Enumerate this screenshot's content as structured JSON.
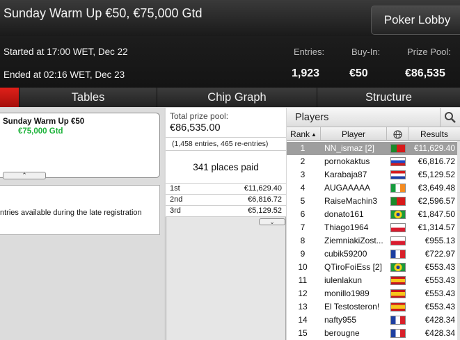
{
  "header": {
    "title": "Sunday Warm Up €50, €75,000 Gtd",
    "lobby_button": "Poker Lobby",
    "started": "Started at 17:00 WET, Dec 22",
    "ended": "Ended at 02:16 WET, Dec 23",
    "entries_label": "Entries:",
    "entries_value": "1,923",
    "buyin_label": "Buy-In:",
    "buyin_value": "€50",
    "prize_label": "Prize Pool:",
    "prize_value": "€86,535"
  },
  "tabs": [
    "Tables",
    "Chip Graph",
    "Structure"
  ],
  "left": {
    "card_name": "Sunday Warm Up €50",
    "card_gtd": "€75,000 Gtd",
    "info_text": "ntries available during the late registration"
  },
  "middle": {
    "pool_label": "Total prize pool:",
    "pool_value": "€86,535.00",
    "entries_text": "(1,458 entries, 465 re-entries)",
    "places_paid": "341 places paid",
    "payouts": [
      {
        "place": "1st",
        "amount": "€11,629.40"
      },
      {
        "place": "2nd",
        "amount": "€6,816.72"
      },
      {
        "place": "3rd",
        "amount": "€5,129.52"
      }
    ]
  },
  "players": {
    "title": "Players",
    "columns": {
      "rank": "Rank",
      "player": "Player",
      "results": "Results"
    },
    "rows": [
      {
        "rank": "1",
        "name": "NN_ismaz [2]",
        "flag": "portugal-flag",
        "result": "€11,629.40"
      },
      {
        "rank": "2",
        "name": "pornokaktus",
        "flag": "russia-flag",
        "result": "€6,816.72"
      },
      {
        "rank": "3",
        "name": "Karabaja87",
        "flag": "croatia-flag",
        "result": "€5,129.52"
      },
      {
        "rank": "4",
        "name": "AUGAAAAA",
        "flag": "ireland-flag",
        "result": "€3,649.48"
      },
      {
        "rank": "5",
        "name": "RaiseMachin3",
        "flag": "portugal-flag",
        "result": "€2,596.57"
      },
      {
        "rank": "6",
        "name": "donato161",
        "flag": "brazil-flag",
        "result": "€1,847.50"
      },
      {
        "rank": "7",
        "name": "Thiago1964",
        "flag": "poland-flag",
        "result": "€1,314.57"
      },
      {
        "rank": "8",
        "name": "ZiemniakiZost...",
        "flag": "poland-flag",
        "result": "€955.13"
      },
      {
        "rank": "9",
        "name": "cubik59200",
        "flag": "france-flag",
        "result": "€722.97"
      },
      {
        "rank": "10",
        "name": "QTiroFoiEss [2]",
        "flag": "brazil-flag",
        "result": "€553.43"
      },
      {
        "rank": "11",
        "name": "iulenlakun",
        "flag": "spain-flag",
        "result": "€553.43"
      },
      {
        "rank": "12",
        "name": "monillo1989",
        "flag": "spain-flag",
        "result": "€553.43"
      },
      {
        "rank": "13",
        "name": "El Testosteron!",
        "flag": "spain-flag",
        "result": "€553.43"
      },
      {
        "rank": "14",
        "name": "nafty955",
        "flag": "france-flag",
        "result": "€428.34"
      },
      {
        "rank": "15",
        "name": "berougne",
        "flag": "france-flag",
        "result": "€428.34"
      }
    ]
  },
  "colors": {
    "accent_red": "#d81a14",
    "gtd_green": "#1db33a",
    "selected_row": "#9e9e9e"
  }
}
